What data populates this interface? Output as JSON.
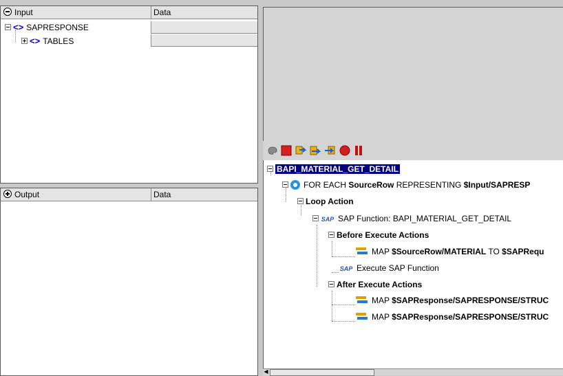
{
  "input_panel": {
    "header": {
      "col1": "Input",
      "col2": "Data"
    },
    "tree": [
      {
        "label": "SAPRESPONSE"
      },
      {
        "label": "TABLES"
      }
    ]
  },
  "output_panel": {
    "header": {
      "col1": "Output",
      "col2": "Data"
    }
  },
  "toolbar": {
    "icons": [
      "palette-icon",
      "stop-icon",
      "step-into-icon",
      "step-over-icon",
      "step-out-icon",
      "record-icon",
      "pause-icon"
    ],
    "stop_color": "#d21f1f",
    "record_color": "#d21f1f",
    "pause_color": "#c01010"
  },
  "flow": {
    "root": "BAPI_MATERIAL_GET_DETAIL",
    "foreach": {
      "prefix": "FOR EACH ",
      "var": "SourceRow",
      "mid": " REPRESENTING ",
      "path": "$Input/SAPRESP"
    },
    "loop_action": "Loop Action",
    "sap_function": "SAP Function: BAPI_MATERIAL_GET_DETAIL",
    "before": "Before Execute Actions",
    "map1": {
      "prefix": "MAP ",
      "src": "$SourceRow/MATERIAL",
      "mid": " TO ",
      "dst": "$SAPRequ"
    },
    "execute": "Execute SAP Function",
    "after": "After Execute Actions",
    "map2": {
      "prefix": "MAP ",
      "src": "$SAPResponse/SAPRESPONSE/STRUC"
    },
    "map3": {
      "prefix": "MAP ",
      "src": "$SAPResponse/SAPRESPONSE/STRUC"
    },
    "sap_label": "SAP"
  }
}
